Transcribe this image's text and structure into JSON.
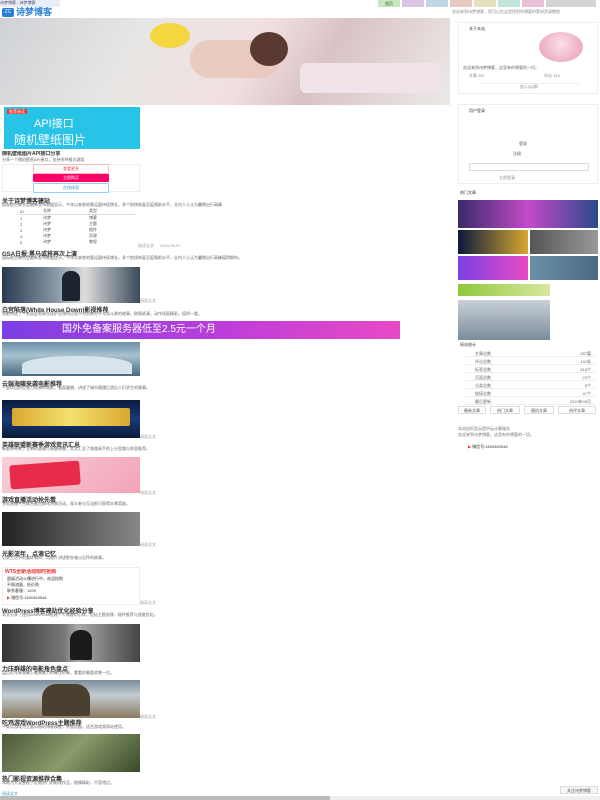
{
  "browser": {
    "tab_title": "诗梦博客 - 诗梦博客"
  },
  "header": {
    "logo_text": "诗梦博客",
    "logo_mark": "ZC",
    "top_right_notice": "欢迎来到诗梦博客，您可以在这里找到你想要的素材资源教程",
    "nav_tabs": [
      "首页",
      "",
      "",
      " ",
      "",
      "",
      "",
      ""
    ],
    "colors": {
      "tab1": "#c9e6c0",
      "tab2": "#d9c4e6",
      "tab3": "#c0d8e6",
      "tab4": "#e6c9c0",
      "tab5": "#e6e0c0",
      "tab6": "#c0e6dc",
      "tab7": "#e6c0d4",
      "tab8": "#d4d4d4"
    }
  },
  "hero": {
    "alt": "banner photo"
  },
  "ad_api": {
    "badge": "推荐阅读",
    "line1": "API接口",
    "line2": "随机壁纸图片",
    "caption": "随机壁纸图片API接口分享",
    "desc": "分享一个随机壁纸API接口，支持多种格式调用",
    "btn_view": "查看更多",
    "btn_buy": "立即购买",
    "btn_try": "在线体验"
  },
  "table_post": {
    "title": "关于诗梦博客建站",
    "rows": [
      [
        "ID",
        "名称",
        "类型"
      ],
      [
        "1",
        "诗梦",
        "博客"
      ],
      [
        "2",
        "诗梦",
        "主题"
      ],
      [
        "3",
        "诗梦",
        "插件"
      ],
      [
        "4",
        "诗梦",
        "资源"
      ],
      [
        "5",
        "诗梦",
        "教程"
      ]
    ],
    "more": "阅读全文",
    "date": "2019-05-07"
  },
  "posts": [
    {
      "title": "GSA日报:黑马或将再次上演",
      "snippet": "国际航空联合会最新发布数据显示，今年以来各地客运量持续增长，多个航线恢复至疫情前水平，业内人士认为暑期出行高峰值得期待。",
      "more": "阅读全文",
      "date": ""
    },
    {
      "title": "白宫陷落(White House Down)影视推荐",
      "snippet": "电影讲述了一名国会警察在保护总统的过程中与恐怖分子斗智斗勇的故事，剧情紧凑，动作场面精彩，值得一看。",
      "more": "阅读全文"
    },
    {
      "title": "云端海啸来袭电影推荐",
      "snippet": "一部以自然灾害为背景的电影，画面震撼，讲述了城市遭遇巨浪后人们求生的故事。",
      "more": "阅读全文"
    },
    {
      "title": "英雄联盟新赛季游戏资讯汇总",
      "snippet": "新赛季带来了全新的英雄与装备调整，本文汇总了各路高手的上分思路与阵容推荐。",
      "more": "阅读全文"
    },
    {
      "title": "游戏直播活动抢先看",
      "snippet": "多家直播平台联合推出周年庆典活动，观众参与互动即可获得丰厚奖励。",
      "more": "阅读全文"
    },
    {
      "title": "光影流年，点滴记忆",
      "snippet": "记录生活中的美好瞬间，用照片讲述那些难以忘怀的故事。",
      "more": "阅读全文"
    },
    {
      "title": "WordPress博客建站优化经验分享",
      "snippet": "本文分享了使用WordPress搭建个人博客的心得，包括主题选择、插件推荐与速度优化。",
      "more": "阅读全文"
    },
    {
      "title": "力压群雄的电影角色盘点",
      "snippet": "盘点近年来银幕上最具魅力的硬汉形象，看看你最喜欢哪一位。",
      "more": "阅读全文"
    },
    {
      "title": "吃鸡游戏WordPress主题推荐",
      "snippet": "一款以游戏为主题风格的博客模板，界面炫酷，适合游戏类网站使用。",
      "more": "阅读全文"
    },
    {
      "title": "热门影视资源推荐合集",
      "snippet": "本期为大家整理了近期热门的影视作品，剧情精彩，不容错过。",
      "more": "阅读全文"
    }
  ],
  "banner_cloud": {
    "text": "国外免备案服务器低至2.5元一个月"
  },
  "ad_box": {
    "line1": "WTS全新活动限时抢购",
    "line2": "超级活动火爆进行中，欢迎抢购",
    "line3": "不限流量，低价购",
    "line4": "联系客服：1209",
    "contact": "微信号:1600463548"
  },
  "sidebar": {
    "author": {
      "title": "关于本站",
      "name": "诗梦",
      "desc": "欢迎来到诗梦博客，这里有你想要的一切。",
      "stats": [
        {
          "label": "文章",
          "value": "287"
        },
        {
          "label": "评论",
          "value": "142"
        }
      ],
      "btn": "加入QQ群"
    },
    "login": {
      "title": "用户登录",
      "login_label": "登录",
      "register_label": "注册",
      "action": "立即登录"
    },
    "hot_title": "热门文章",
    "site_stats": {
      "title": "网站统计",
      "rows": [
        {
          "label": "文章总数",
          "value": "287篇"
        },
        {
          "label": "评论总数",
          "value": "142条"
        },
        {
          "label": "标签总数",
          "value": "618个"
        },
        {
          "label": "页面总数",
          "value": "24个"
        },
        {
          "label": "分类总数",
          "value": "8个"
        },
        {
          "label": "链接总数",
          "value": "47个"
        },
        {
          "label": "最后更新",
          "value": "2019年05月"
        }
      ]
    },
    "tabs": [
      "最新文章",
      "热门文章",
      "随机文章",
      "热评文章"
    ],
    "contact": "微信号:1600463548",
    "footer_note": "本站由阿里云提供云计算服务"
  },
  "bottom_bar": {
    "label": "关注诗梦博客"
  }
}
